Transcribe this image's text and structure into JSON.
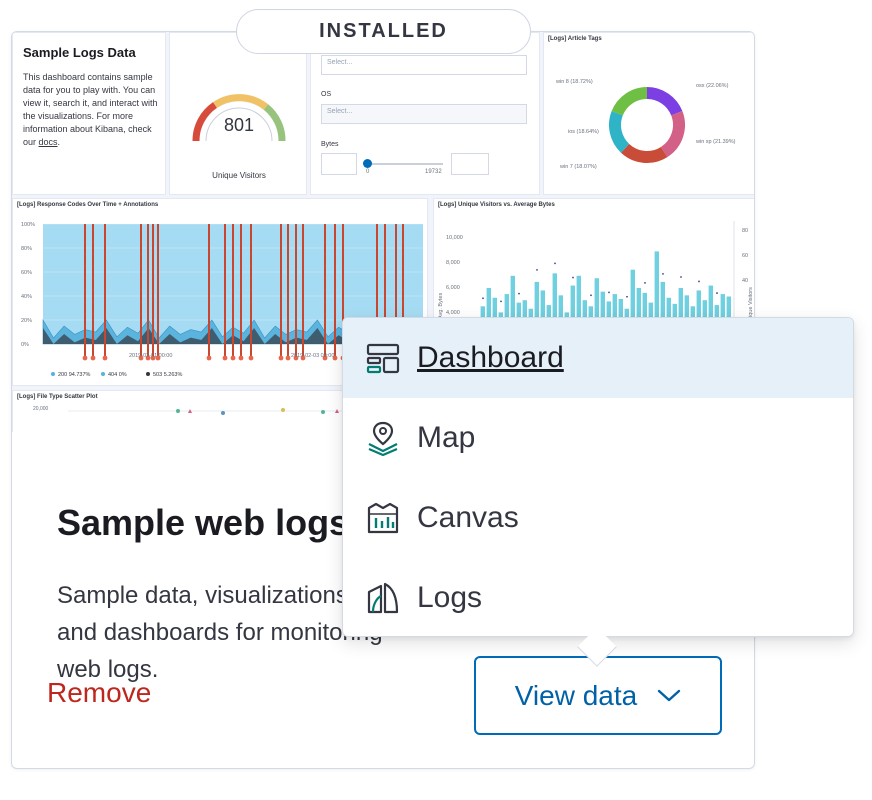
{
  "badge": {
    "label": "INSTALLED"
  },
  "preview": {
    "markdown": {
      "title": "Sample Logs Data",
      "body": "This dashboard contains sample data for you to play with. You can view it, search it, and interact with the visualizations. For more information about Kibana, check our",
      "link": "docs",
      "link_suffix": "."
    },
    "gauge": {
      "value": "801",
      "label": "Unique Visitors"
    },
    "controls": {
      "select_placeholder": "Select...",
      "os_label": "OS",
      "os_placeholder": "Select...",
      "bytes_label": "Bytes",
      "bytes_min": "0",
      "bytes_max": "19732"
    },
    "tags": {
      "title": "[Logs] Article Tags",
      "labels": [
        "win 8 (18.72%)",
        "osx (22.06%)",
        "ios (18.64%)",
        "win xp (21.39%)",
        "win 7 (18.07%)"
      ],
      "colors": [
        "#7b3fe4",
        "#d36086",
        "#c84c37",
        "#2fb3c7",
        "#70bf45"
      ]
    },
    "response": {
      "title": "[Logs] Response Codes Over Time + Annotations",
      "y_ticks": [
        "100%",
        "80%",
        "60%",
        "40%",
        "20%",
        "0%"
      ],
      "x_ticks": [
        "2019-02-01 00:00",
        "2019-02-03 00:00"
      ],
      "legend": [
        "200 94.737%",
        "404 0%",
        "503 5.263%"
      ],
      "legend_colors": [
        "#54b3e0",
        "#54b3e0",
        "#343741"
      ]
    },
    "visitors": {
      "title": "[Logs] Unique Visitors vs. Average Bytes",
      "y_ticks": [
        "10,000",
        "8,000",
        "6,000",
        "4,000"
      ],
      "y_label": "Avg. Bytes",
      "y2_ticks": [
        "80",
        "60",
        "40"
      ],
      "y2_label": "Unique Visitors"
    },
    "scatter": {
      "title": "[Logs] File Type Scatter Plot",
      "y_tick": "20,000"
    }
  },
  "card": {
    "title": "Sample web logs",
    "description": "Sample data, visualizations, and dashboards for monitoring web logs.",
    "remove_label": "Remove",
    "view_data_label": "View data"
  },
  "menu": {
    "items": [
      {
        "label": "Dashboard",
        "icon": "dashboard-app-icon",
        "active": true
      },
      {
        "label": "Map",
        "icon": "maps-app-icon",
        "active": false
      },
      {
        "label": "Canvas",
        "icon": "canvas-app-icon",
        "active": false
      },
      {
        "label": "Logs",
        "icon": "logs-app-icon",
        "active": false
      }
    ]
  },
  "colors": {
    "accent": "#006bb8",
    "danger": "#bd271e",
    "active_bg": "#e6f0f8",
    "icon_teal": "#017d73"
  }
}
